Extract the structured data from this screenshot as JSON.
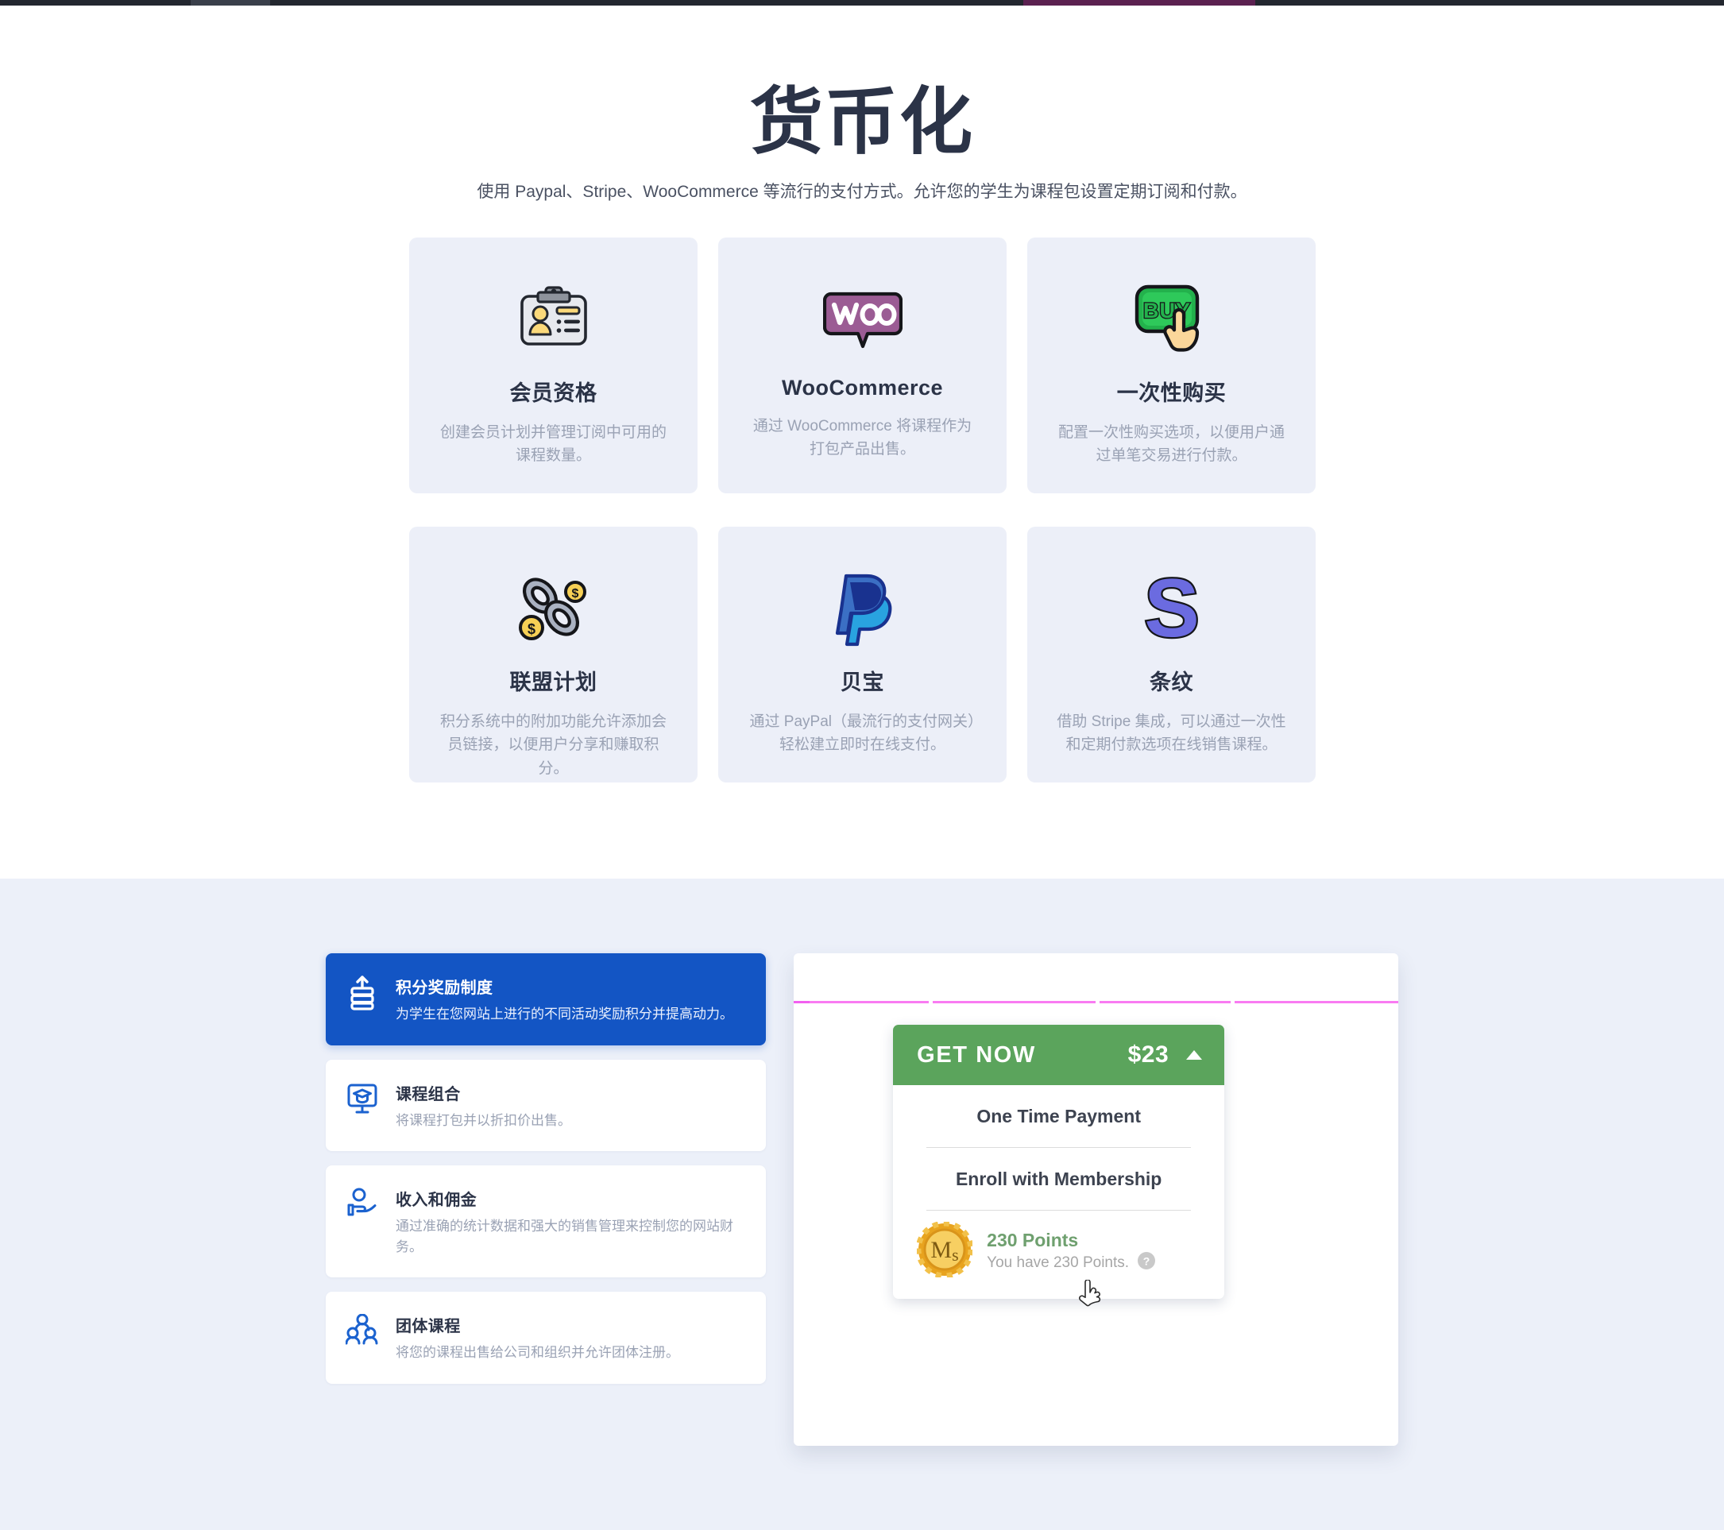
{
  "hero": {
    "title": "货币化",
    "subtitle": "使用 Paypal、Stripe、WooCommerce 等流行的支付方式。允许您的学生为课程包设置定期订阅和付款。"
  },
  "features": [
    {
      "icon": "id-badge-icon",
      "title": "会员资格",
      "desc": "创建会员计划并管理订阅中可用的课程数量。"
    },
    {
      "icon": "woocommerce-logo-icon",
      "title": "WooCommerce",
      "desc": "通过 WooCommerce 将课程作为打包产品出售。"
    },
    {
      "icon": "buy-button-hand-icon",
      "title": "一次性购买",
      "desc": "配置一次性购买选项，以便用户通过单笔交易进行付款。"
    },
    {
      "icon": "chain-coins-icon",
      "title": "联盟计划",
      "desc": "积分系统中的附加功能允许添加会员链接，以便用户分享和赚取积分。"
    },
    {
      "icon": "paypal-logo-icon",
      "title": "贝宝",
      "desc": "通过 PayPal（最流行的支付网关）轻松建立即时在线支付。"
    },
    {
      "icon": "stripe-logo-icon",
      "title": "条纹",
      "desc": "借助 Stripe 集成，可以通过一次性和定期付款选项在线销售课程。"
    }
  ],
  "accordion": [
    {
      "icon": "points-stack-up-icon",
      "title": "积分奖励制度",
      "desc": "为学生在您网站上进行的不同活动奖励积分并提高动力。",
      "active": true
    },
    {
      "icon": "course-bundle-monitor-icon",
      "title": "课程组合",
      "desc": "将课程打包并以折扣价出售。",
      "active": false
    },
    {
      "icon": "earnings-hand-icon",
      "title": "收入和佣金",
      "desc": "通过准确的统计数据和强大的销售管理来控制您的网站财务。",
      "active": false
    },
    {
      "icon": "group-courses-people-icon",
      "title": "团体课程",
      "desc": "将您的课程出售给公司和组织并允许团体注册。",
      "active": false
    }
  ],
  "preview": {
    "get_now": {
      "label": "GET NOW",
      "price": "$23",
      "caret": "caret-up-icon",
      "options": [
        "One Time Payment",
        "Enroll with Membership"
      ],
      "points": {
        "coin_letters": "MS",
        "main": "230 Points",
        "sub": "You have 230 Points.",
        "help": "help-circle-icon"
      }
    }
  },
  "colors": {
    "brand_blue": "#1355c4",
    "get_now_green": "#5ba45c",
    "points_green": "#6fa06f",
    "section_bg": "#ecf0f9",
    "card_bg": "#eceff8",
    "pink_rule": "#f97bf2",
    "heading": "#2b3347",
    "muted": "#9aa2b4"
  }
}
